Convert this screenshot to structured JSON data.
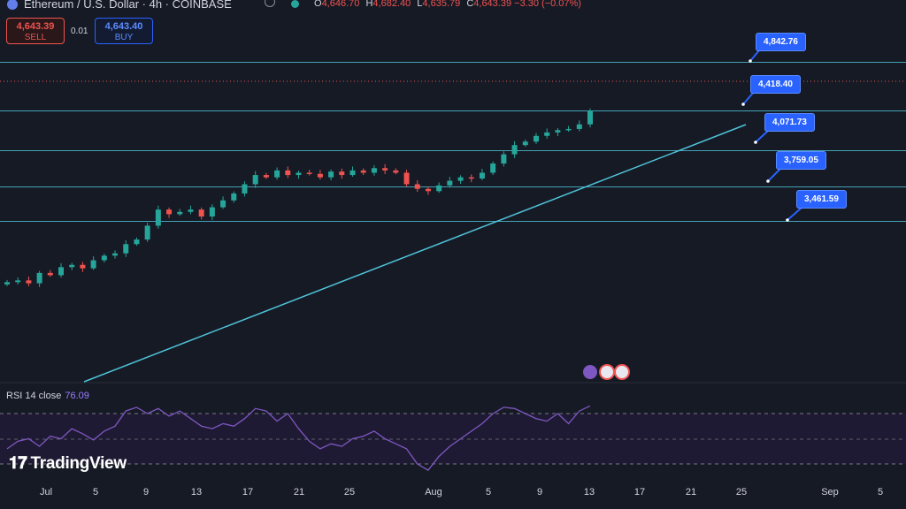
{
  "header": {
    "symbol": "Ethereum / U.S. Dollar · 4h · COINBASE",
    "ohlc": [
      {
        "key": "O",
        "value": "4,646.70"
      },
      {
        "key": "H",
        "value": "4,682.40"
      },
      {
        "key": "L",
        "value": "4,635.79"
      },
      {
        "key": "C",
        "value": "4,643.39 −3.30 (−0.07%)"
      }
    ]
  },
  "trade": {
    "sell_price": "4,643.39",
    "sell_label": "SELL",
    "spread": "0.01",
    "buy_price": "4,643.40",
    "buy_label": "BUY"
  },
  "rsi": {
    "label": "RSI 14 close",
    "value": "76.09"
  },
  "logo": "TradingView",
  "price_tags": [
    "4,842.76",
    "4,418.40",
    "4,071.73",
    "3,759.05",
    "3,461.59"
  ],
  "x_axis_labels": [
    "Jul",
    "5",
    "9",
    "13",
    "17",
    "21",
    "25",
    "Aug",
    "5",
    "9",
    "13",
    "17",
    "21",
    "25",
    "Sep",
    "5"
  ],
  "colors": {
    "background": "#161a25",
    "up": "#26a69a",
    "down": "#ef5350",
    "level_line": "#4fc3d9",
    "rsi": "#7e57c2",
    "tag": "#2962ff"
  },
  "chart_data": {
    "type": "candlestick",
    "price_levels": [
      4842.76,
      4418.4,
      4071.73,
      3759.05,
      3461.59
    ],
    "trendline": [
      [
        2900,
        4380
      ],
      [
        4180,
        3980
      ]
    ],
    "series": [
      {
        "values": [
          2930,
          2945,
          2920,
          3010,
          2990,
          3060,
          3080,
          3050,
          3120,
          3160,
          3180,
          3260,
          3300,
          3420,
          3560,
          3520,
          3540,
          3560,
          3500,
          3580,
          3640,
          3700,
          3780,
          3860,
          3840,
          3900,
          3860,
          3880,
          3870,
          3840,
          3890,
          3860,
          3900,
          3880,
          3920,
          3900,
          3880,
          3780,
          3740,
          3720,
          3770,
          3810,
          3840,
          3830,
          3880,
          3960,
          4040,
          4120,
          4150,
          4200,
          4230,
          4250,
          4260,
          4300,
          4420
        ]
      },
      {
        "name": "RSI 14 close",
        "values": [
          42,
          48,
          50,
          44,
          52,
          50,
          58,
          54,
          49,
          56,
          60,
          72,
          75,
          70,
          74,
          68,
          72,
          66,
          60,
          58,
          62,
          60,
          66,
          74,
          72,
          64,
          70,
          58,
          48,
          42,
          46,
          44,
          50,
          52,
          56,
          50,
          46,
          42,
          30,
          25,
          36,
          44,
          50,
          56,
          62,
          70,
          75,
          74,
          70,
          66,
          64,
          70,
          62,
          72,
          76.09
        ]
      }
    ]
  }
}
